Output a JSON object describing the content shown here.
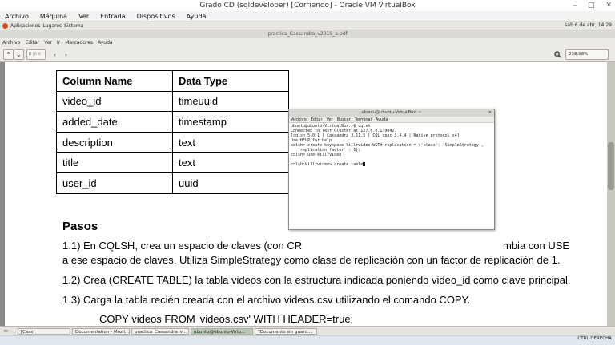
{
  "vbox": {
    "title": "Grado CD (sqldeveloper) [Corriendo] - Oracle VM VirtualBox",
    "menu": [
      "Archivo",
      "Máquina",
      "Ver",
      "Entrada",
      "Dispositivos",
      "Ayuda"
    ],
    "controls": [
      "–",
      "□",
      "✕"
    ],
    "host_key": "CTRL DERECHA"
  },
  "guest_panel": {
    "items": [
      "Aplicaciones",
      "Lugares",
      "Sistema"
    ],
    "clock": "sáb 6 de abr, 14:29"
  },
  "evince": {
    "title": "practica_Cassandra_v2019_a.pdf",
    "menu": [
      "Archivo",
      "Editar",
      "Ver",
      "Ir",
      "Marcadores",
      "Ayuda"
    ],
    "page_current": "6",
    "page_total": "(6 d",
    "zoom": "238,98%"
  },
  "doc": {
    "table": {
      "headers": [
        "Column Name",
        "Data Type"
      ],
      "rows": [
        [
          "video_id",
          "timeuuid"
        ],
        [
          "added_date",
          "timestamp"
        ],
        [
          "description",
          "text"
        ],
        [
          "title",
          "text"
        ],
        [
          "user_id",
          "uuid"
        ]
      ]
    },
    "section_title": "Pasos",
    "step1_line1": "1.1) En CQLSH, crea un espacio de claves (con CR",
    "step1_tail": "mbia con USE",
    "step1_line2": "a ese espacio de claves. Utiliza SimpleStrategy como clase de replicación con un factor de replicación de 1.",
    "step2": "1.2) Crea (CREATE TABLE) la tabla videos con la estructura indicada poniendo video_id como clave principal.",
    "step3": "1.3) Carga la tabla recién creada con el archivo videos.csv utilizando el comando COPY.",
    "copy_cmd": "COPY videos FROM 'videos.csv' WITH HEADER=true;"
  },
  "terminal": {
    "title": "ubuntu@ubuntu-VirtualBox: ~",
    "close": "✕",
    "menu": [
      "Archivo",
      "Editar",
      "Ver",
      "Buscar",
      "Terminal",
      "Ayuda"
    ],
    "lines": [
      "ubuntu@ubuntu-VirtualBox:~$ cqlsh",
      "Connected to Test Cluster at 127.0.0.1:9042.",
      "[cqlsh 5.0.1 | Cassandra 3.11.5 | CQL spec 3.4.4 | Native protocol v4]",
      "Use HELP for help.",
      "cqlsh> create keyspace killrvideo WITH replication = {'class': 'SimpleStrategy',",
      "   'replication_factor' : 1};",
      "cqlsh> use killrvideo",
      "",
      "cqlsh:killrvideo> create table"
    ]
  },
  "taskbar": {
    "items": [
      "[Cass]",
      "Documentation - Mozil...",
      "practica_Cassandra_v...",
      "ubuntu@ubuntu-Virtu...",
      "*Documento sin guard..."
    ]
  },
  "colors": {
    "active_task": "#b7cbb2",
    "doc_background": "#8a8986"
  }
}
